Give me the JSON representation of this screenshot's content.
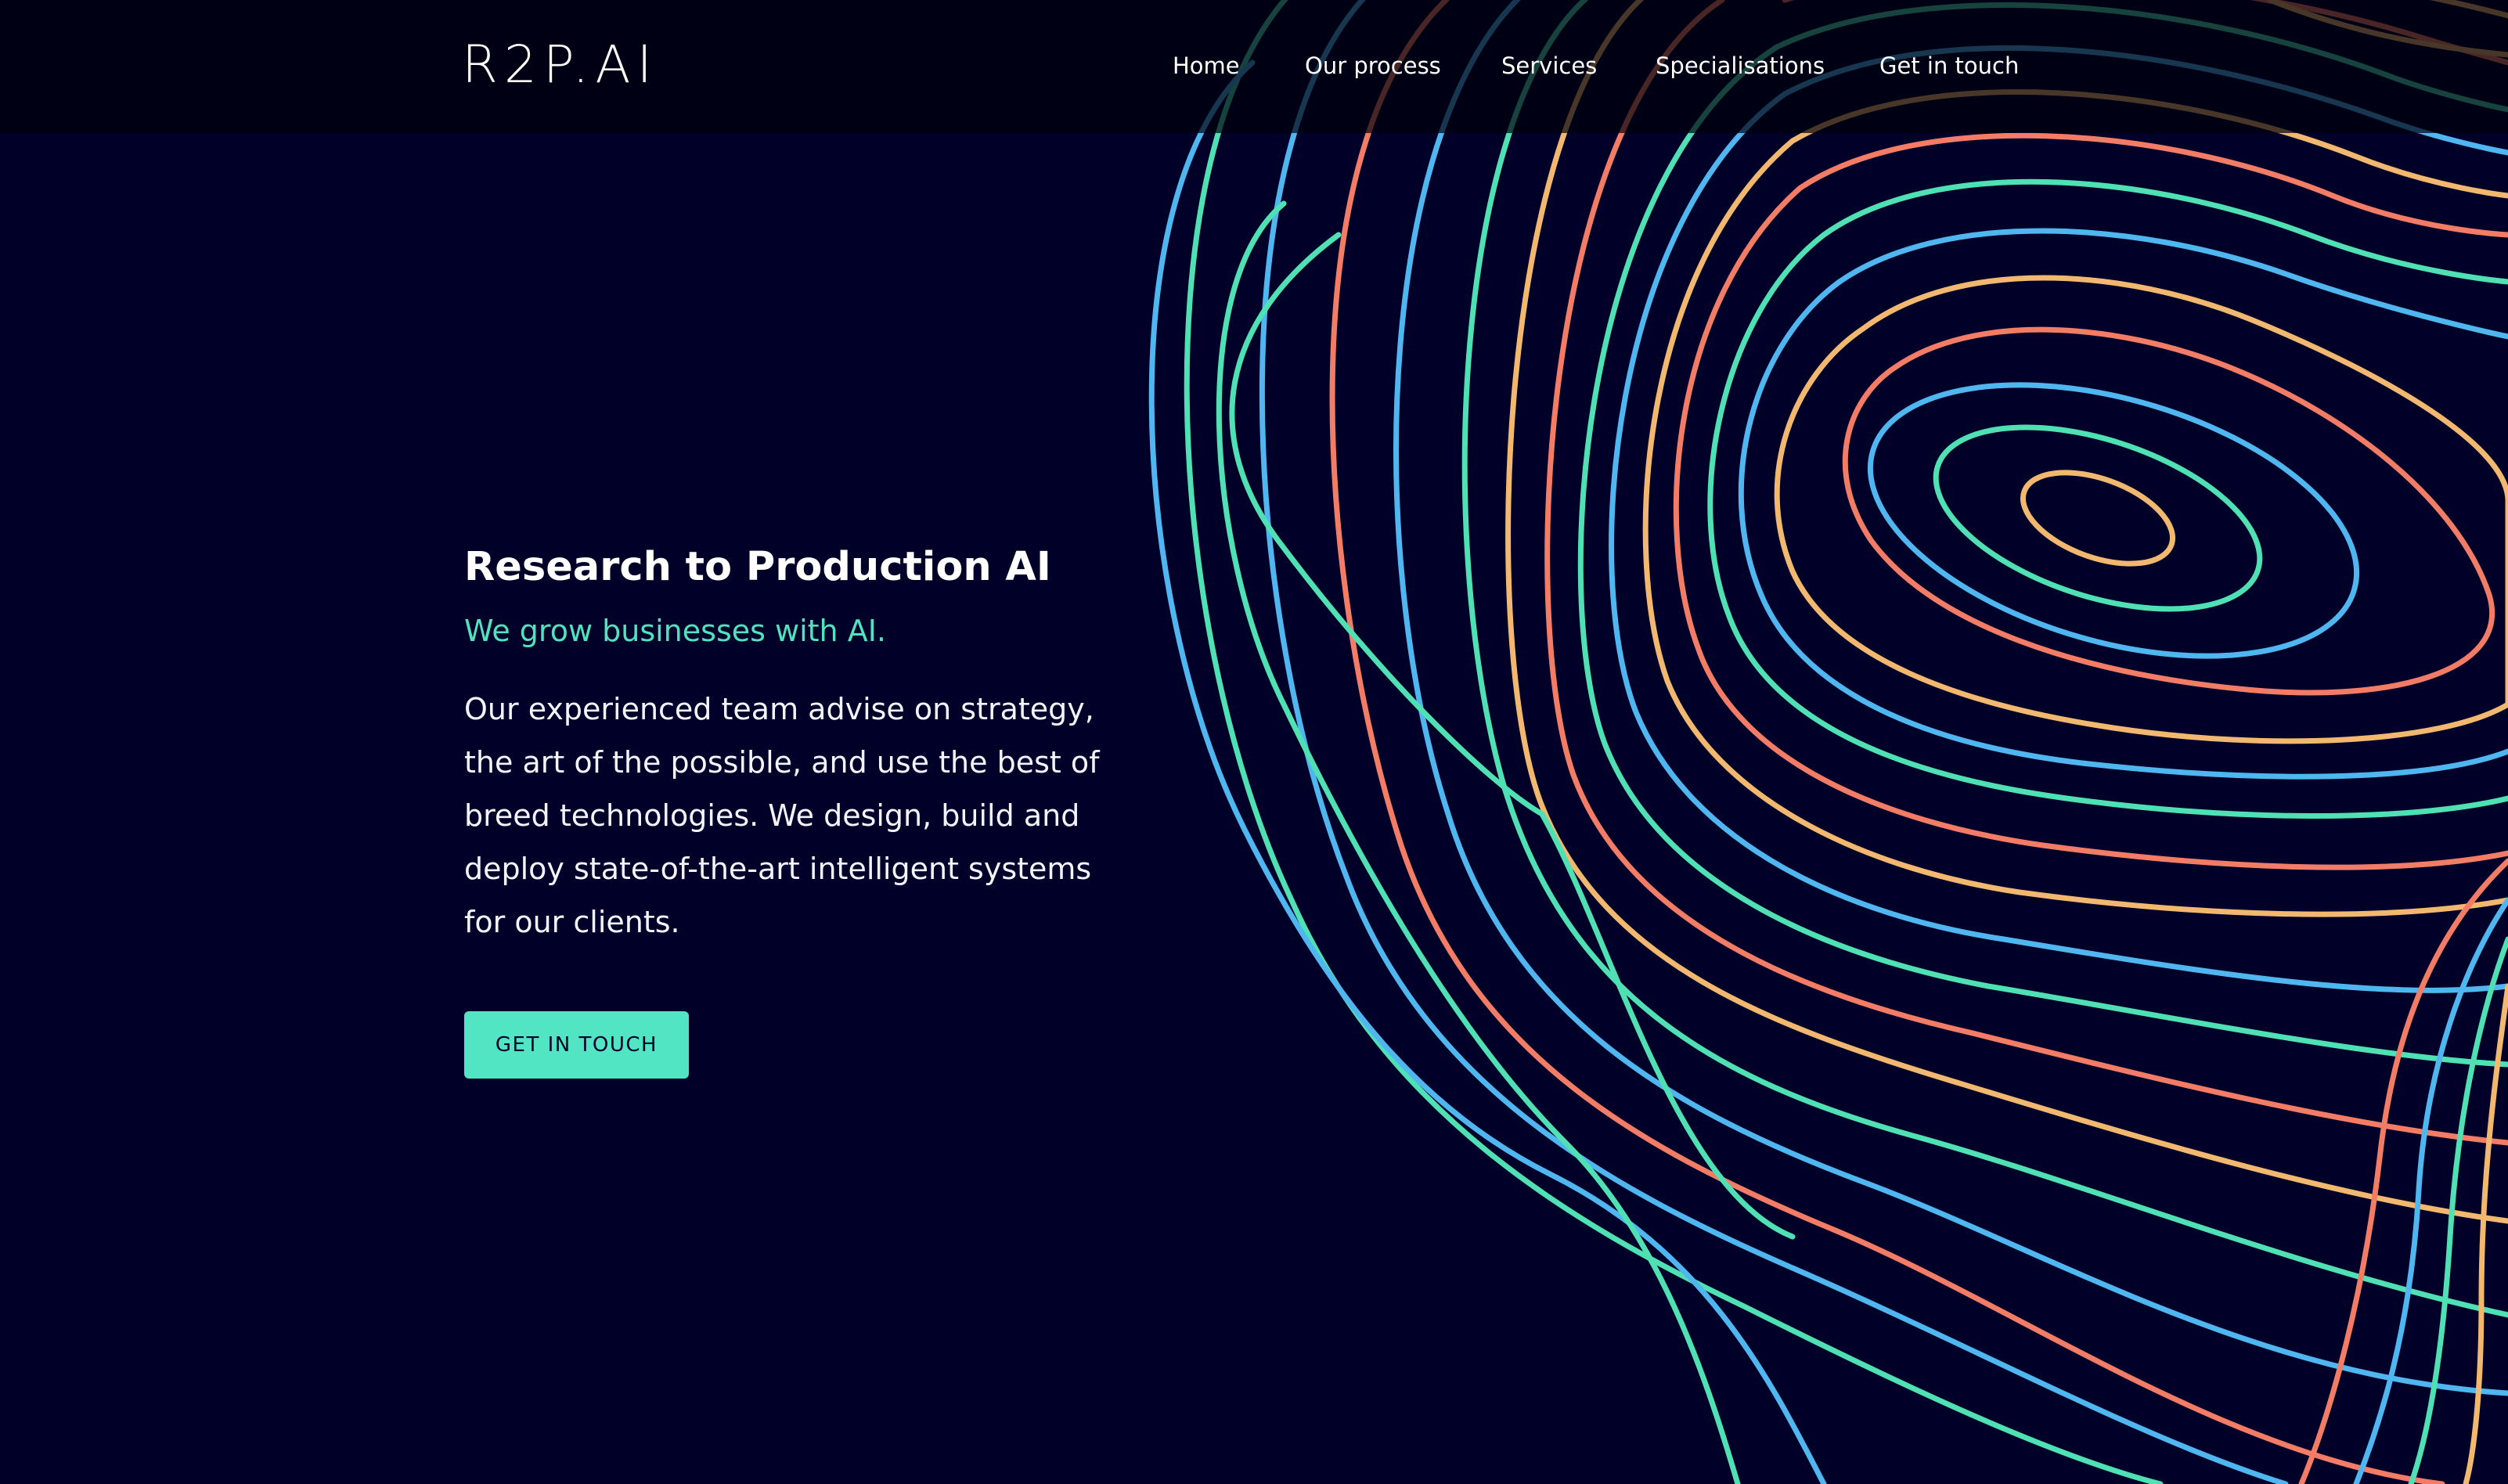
{
  "brand": {
    "logo_text": "R2P.AI"
  },
  "nav": {
    "items": [
      {
        "label": "Home"
      },
      {
        "label": "Our process"
      },
      {
        "label": "Services"
      },
      {
        "label": "Specialisations"
      },
      {
        "label": "Get in touch"
      }
    ]
  },
  "hero": {
    "title": "Research to Production AI",
    "subtitle": "We grow businesses with AI.",
    "body": "Our experienced team advise on strategy, the art of the possible, and use the best of breed technologies. We design, build and deploy state-of-the-art intelligent systems for our clients.",
    "cta_label": "GET IN TOUCH"
  },
  "colors": {
    "background": "#000029",
    "accent": "#52e5c3",
    "contour_green": "#4fe0b4",
    "contour_blue": "#4fb6ef",
    "contour_orange": "#f39a6a",
    "contour_salmon": "#f37c66",
    "contour_gold": "#f2b870"
  }
}
